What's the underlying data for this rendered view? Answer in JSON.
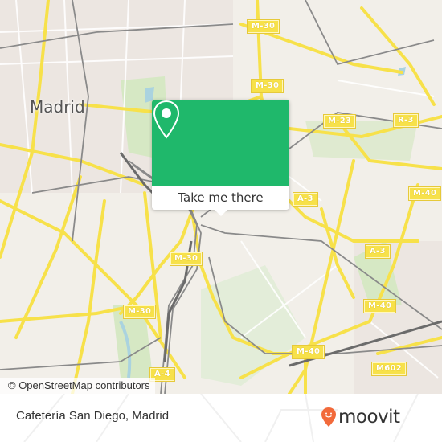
{
  "map": {
    "city_label": "Madrid",
    "road_shields": [
      {
        "label": "M-30"
      },
      {
        "label": "M-30"
      },
      {
        "label": "M-23"
      },
      {
        "label": "R-3"
      },
      {
        "label": "A-3"
      },
      {
        "label": "M-40"
      },
      {
        "label": "A-3"
      },
      {
        "label": "M-30"
      },
      {
        "label": "M-30"
      },
      {
        "label": "M-40"
      },
      {
        "label": "M-40"
      },
      {
        "label": "M602"
      },
      {
        "label": "A-4"
      }
    ],
    "attribution": "© OpenStreetMap contributors",
    "colors": {
      "background": "#f2efe9",
      "road_major": "#f7e14a",
      "rail": "#8a8a8a",
      "park": "#d6e8c4",
      "water": "#aad3df"
    }
  },
  "popup": {
    "action_label": "Take me there",
    "icon": "location-pin-icon",
    "color": "#1fb86b"
  },
  "footer": {
    "place_name": "Cafetería San Diego, Madrid",
    "brand": "moovit",
    "brand_icon": "moovit-pin-smile-icon",
    "brand_color": "#f26a3b"
  }
}
